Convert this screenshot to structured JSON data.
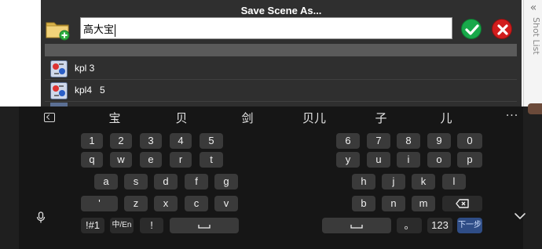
{
  "dialog": {
    "title": "Save Scene As...",
    "filename_value": "高大宝",
    "folder_icon": "new-folder-icon",
    "ok_icon": "check-icon",
    "cancel_icon": "close-icon",
    "colors": {
      "ok": "#18a84a",
      "cancel": "#d11d1d",
      "background": "#2f2f2f"
    }
  },
  "scene_list": {
    "items": [
      {
        "label": "kpl 3",
        "icon": "scene-thumbnail-icon"
      },
      {
        "label": "kpl4   5",
        "icon": "scene-thumbnail-icon"
      }
    ]
  },
  "side_panel": {
    "label": "Shot List",
    "icon": "chevron-left-double-icon"
  },
  "keyboard": {
    "candidates": [
      "宝",
      "贝",
      "剑",
      "贝儿",
      "子",
      "儿"
    ],
    "more_icon": "···",
    "number_row_left": [
      "1",
      "2",
      "3",
      "4",
      "5"
    ],
    "number_row_right": [
      "6",
      "7",
      "8",
      "9",
      "0"
    ],
    "row1_left": [
      "q",
      "w",
      "e",
      "r",
      "t"
    ],
    "row1_right": [
      "y",
      "u",
      "i",
      "o",
      "p"
    ],
    "row2_left": [
      "a",
      "s",
      "d",
      "f",
      "g"
    ],
    "row2_right": [
      "h",
      "j",
      "k",
      "l"
    ],
    "row3_left": [
      "'",
      "z",
      "x",
      "c",
      "v"
    ],
    "row3_right": [
      "b",
      "n",
      "m"
    ],
    "symbols_key": "!#1",
    "lang_key": "中/En",
    "exclaim_key": "!",
    "period_key": "。",
    "num_key": "123",
    "next_key": "下一步",
    "space_icon": "space-icon",
    "backspace_icon": "backspace-icon",
    "mic_icon": "microphone-icon",
    "hide_icon": "chevron-down-icon"
  }
}
